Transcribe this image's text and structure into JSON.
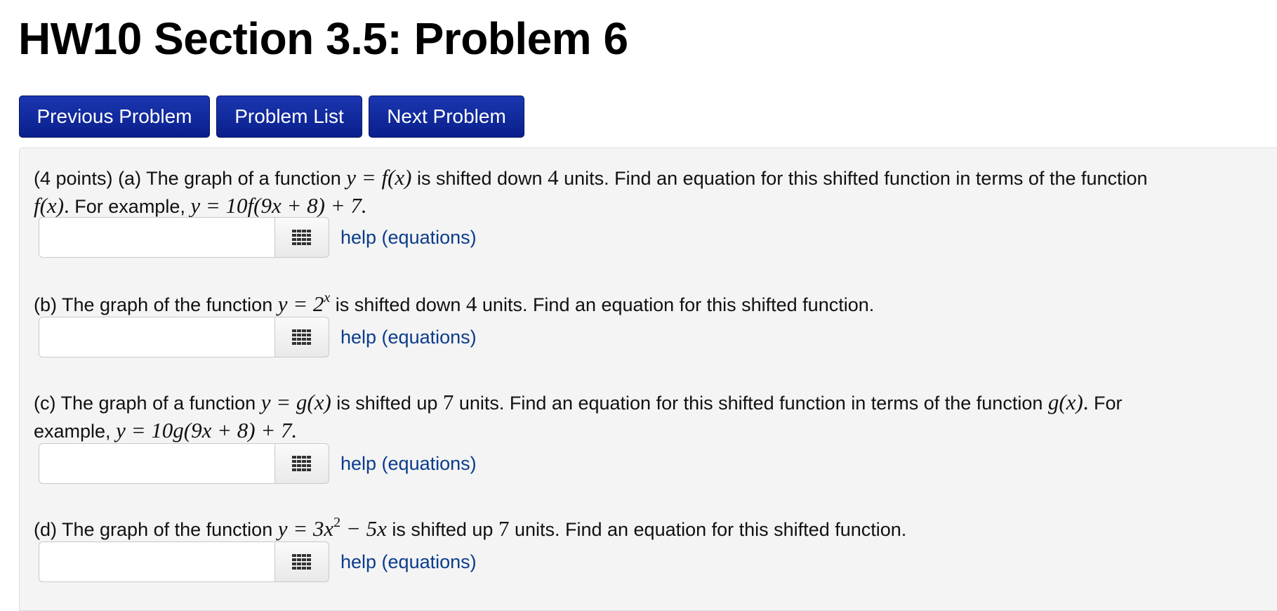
{
  "page_title": "HW10 Section 3.5: Problem 6",
  "nav": {
    "previous_label": "Previous Problem",
    "list_label": "Problem List",
    "next_label": "Next Problem"
  },
  "problem": {
    "points": "(4 points)",
    "help_label": "help (equations)",
    "part_a": {
      "t1": " (a) The graph of a function ",
      "m1": "y = f(x)",
      "t2": " is shifted down ",
      "m2": "4",
      "t3": " units. Find an equation for this shifted function in terms of the function",
      "m3": "f(x)",
      "m3b": ".",
      "t4": " For example, ",
      "m4": "y = 10f(9x + 8) + 7.",
      "input_value": ""
    },
    "part_b": {
      "t1": "(b) The graph of the function ",
      "m1_base": "y = 2",
      "m1_exp": "x",
      "t2": " is shifted down ",
      "m2": "4",
      "t3": " units. Find an equation for this shifted function.",
      "input_value": ""
    },
    "part_c": {
      "t1": "(c) The graph of a function ",
      "m1": "y = g(x)",
      "t2": " is shifted up ",
      "m2": "7",
      "t3": " units. Find an equation for this shifted function in terms of the function ",
      "m3": "g(x)",
      "m3b": ".",
      "t4": " For",
      "t5": "example, ",
      "m4": "y = 10g(9x + 8) + 7.",
      "input_value": ""
    },
    "part_d": {
      "t1": "(d) The graph of the function ",
      "m1a": "y = 3x",
      "m1_exp": "2",
      "m1b": " − 5x",
      "t2": " is shifted up ",
      "m2": "7",
      "t3": " units. Find an equation for this shifted function.",
      "input_value": ""
    }
  },
  "icons": {
    "grid": "keypad-grid-icon"
  },
  "colors": {
    "nav_button_bg": "#0a2299",
    "link": "#0a3c8c",
    "panel_bg": "#f4f4f4"
  }
}
